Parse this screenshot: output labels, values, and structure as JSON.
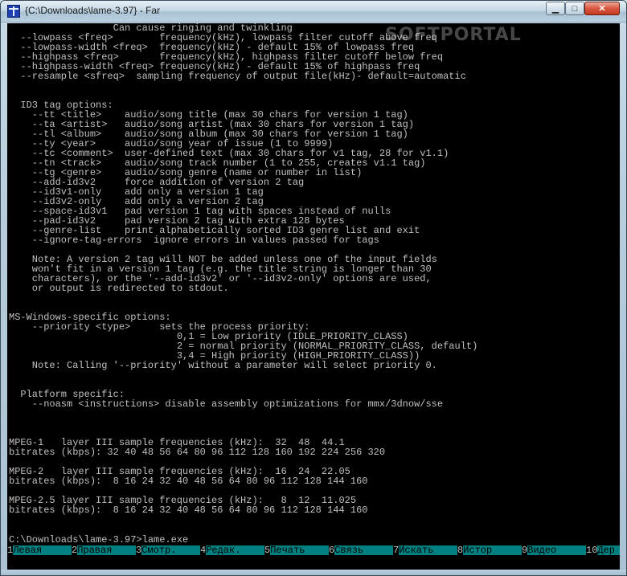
{
  "window": {
    "title": "{C:\\Downloads\\lame-3.97} - Far",
    "minimize_glyph": "▁",
    "maximize_glyph": "□",
    "close_glyph": "✕"
  },
  "watermark": "SOFTPORTAL",
  "console": {
    "text": "                  Can cause ringing and twinkling\n  --lowpass <freq>        frequency(kHz), lowpass filter cutoff above freq\n  --lowpass-width <freq>  frequency(kHz) - default 15% of lowpass freq\n  --highpass <freq>       frequency(kHz), highpass filter cutoff below freq\n  --highpass-width <freq> frequency(kHz) - default 15% of highpass freq\n  --resample <sfreq>  sampling frequency of output file(kHz)- default=automatic\n\n\n  ID3 tag options:\n    --tt <title>    audio/song title (max 30 chars for version 1 tag)\n    --ta <artist>   audio/song artist (max 30 chars for version 1 tag)\n    --tl <album>    audio/song album (max 30 chars for version 1 tag)\n    --ty <year>     audio/song year of issue (1 to 9999)\n    --tc <comment>  user-defined text (max 30 chars for v1 tag, 28 for v1.1)\n    --tn <track>    audio/song track number (1 to 255, creates v1.1 tag)\n    --tg <genre>    audio/song genre (name or number in list)\n    --add-id3v2     force addition of version 2 tag\n    --id3v1-only    add only a version 1 tag\n    --id3v2-only    add only a version 2 tag\n    --space-id3v1   pad version 1 tag with spaces instead of nulls\n    --pad-id3v2     pad version 2 tag with extra 128 bytes\n    --genre-list    print alphabetically sorted ID3 genre list and exit\n    --ignore-tag-errors  ignore errors in values passed for tags\n\n    Note: A version 2 tag will NOT be added unless one of the input fields\n    won't fit in a version 1 tag (e.g. the title string is longer than 30\n    characters), or the '--add-id3v2' or '--id3v2-only' options are used,\n    or output is redirected to stdout.\n\n\nMS-Windows-specific options:\n    --priority <type>     sets the process priority:\n                             0,1 = Low priority (IDLE_PRIORITY_CLASS)\n                             2 = normal priority (NORMAL_PRIORITY_CLASS, default)\n                             3,4 = High priority (HIGH_PRIORITY_CLASS))\n    Note: Calling '--priority' without a parameter will select priority 0.\n\n\n  Platform specific:\n    --noasm <instructions> disable assembly optimizations for mmx/3dnow/sse\n\n\n\nMPEG-1   layer III sample frequencies (kHz):  32  48  44.1\nbitrates (kbps): 32 40 48 56 64 80 96 112 128 160 192 224 256 320\n\nMPEG-2   layer III sample frequencies (kHz):  16  24  22.05\nbitrates (kbps):  8 16 24 32 40 48 56 64 80 96 112 128 144 160\n\nMPEG-2.5 layer III sample frequencies (kHz):   8  12  11.025\nbitrates (kbps):  8 16 24 32 40 48 56 64 80 96 112 128 144 160",
    "prompt": "C:\\Downloads\\lame-3.97>lame.exe"
  },
  "keybar": [
    {
      "num": "1",
      "label": "Левая"
    },
    {
      "num": "2",
      "label": "Правая"
    },
    {
      "num": "3",
      "label": "Смотр."
    },
    {
      "num": "4",
      "label": "Редак."
    },
    {
      "num": "5",
      "label": "Печать"
    },
    {
      "num": "6",
      "label": "Связь"
    },
    {
      "num": "7",
      "label": "Искать"
    },
    {
      "num": "8",
      "label": "Истор"
    },
    {
      "num": "9",
      "label": "Видео"
    },
    {
      "num": "10",
      "label": "Дер"
    }
  ],
  "colors": {
    "console_bg": "#000000",
    "console_fg": "#c0c0c0",
    "keybar_label_bg": "#008080"
  }
}
